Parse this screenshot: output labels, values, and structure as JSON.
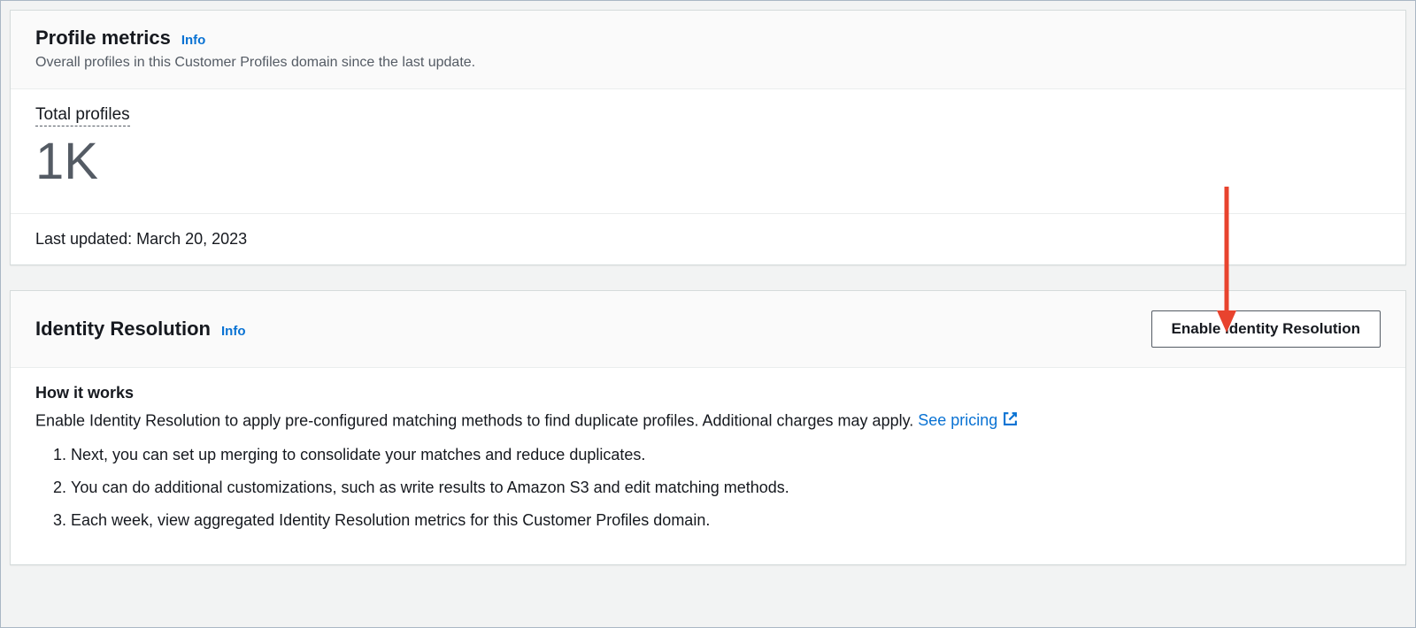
{
  "profileMetrics": {
    "title": "Profile metrics",
    "infoLabel": "Info",
    "subtitle": "Overall profiles in this Customer Profiles domain since the last update.",
    "metricLabel": "Total profiles",
    "metricValue": "1K",
    "lastUpdated": "Last updated: March 20, 2023"
  },
  "identityResolution": {
    "title": "Identity Resolution",
    "infoLabel": "Info",
    "enableButton": "Enable Identity Resolution",
    "howItWorksTitle": "How it works",
    "descriptionPrefix": "Enable Identity Resolution to apply pre-configured matching methods to find duplicate profiles. Additional charges may apply. ",
    "seePricingLabel": "See pricing",
    "steps": [
      "Next, you can set up merging to consolidate your matches and reduce duplicates.",
      "You can do additional customizations, such as write results to Amazon S3 and edit matching methods.",
      "Each week, view aggregated Identity Resolution metrics for this Customer Profiles domain."
    ]
  }
}
